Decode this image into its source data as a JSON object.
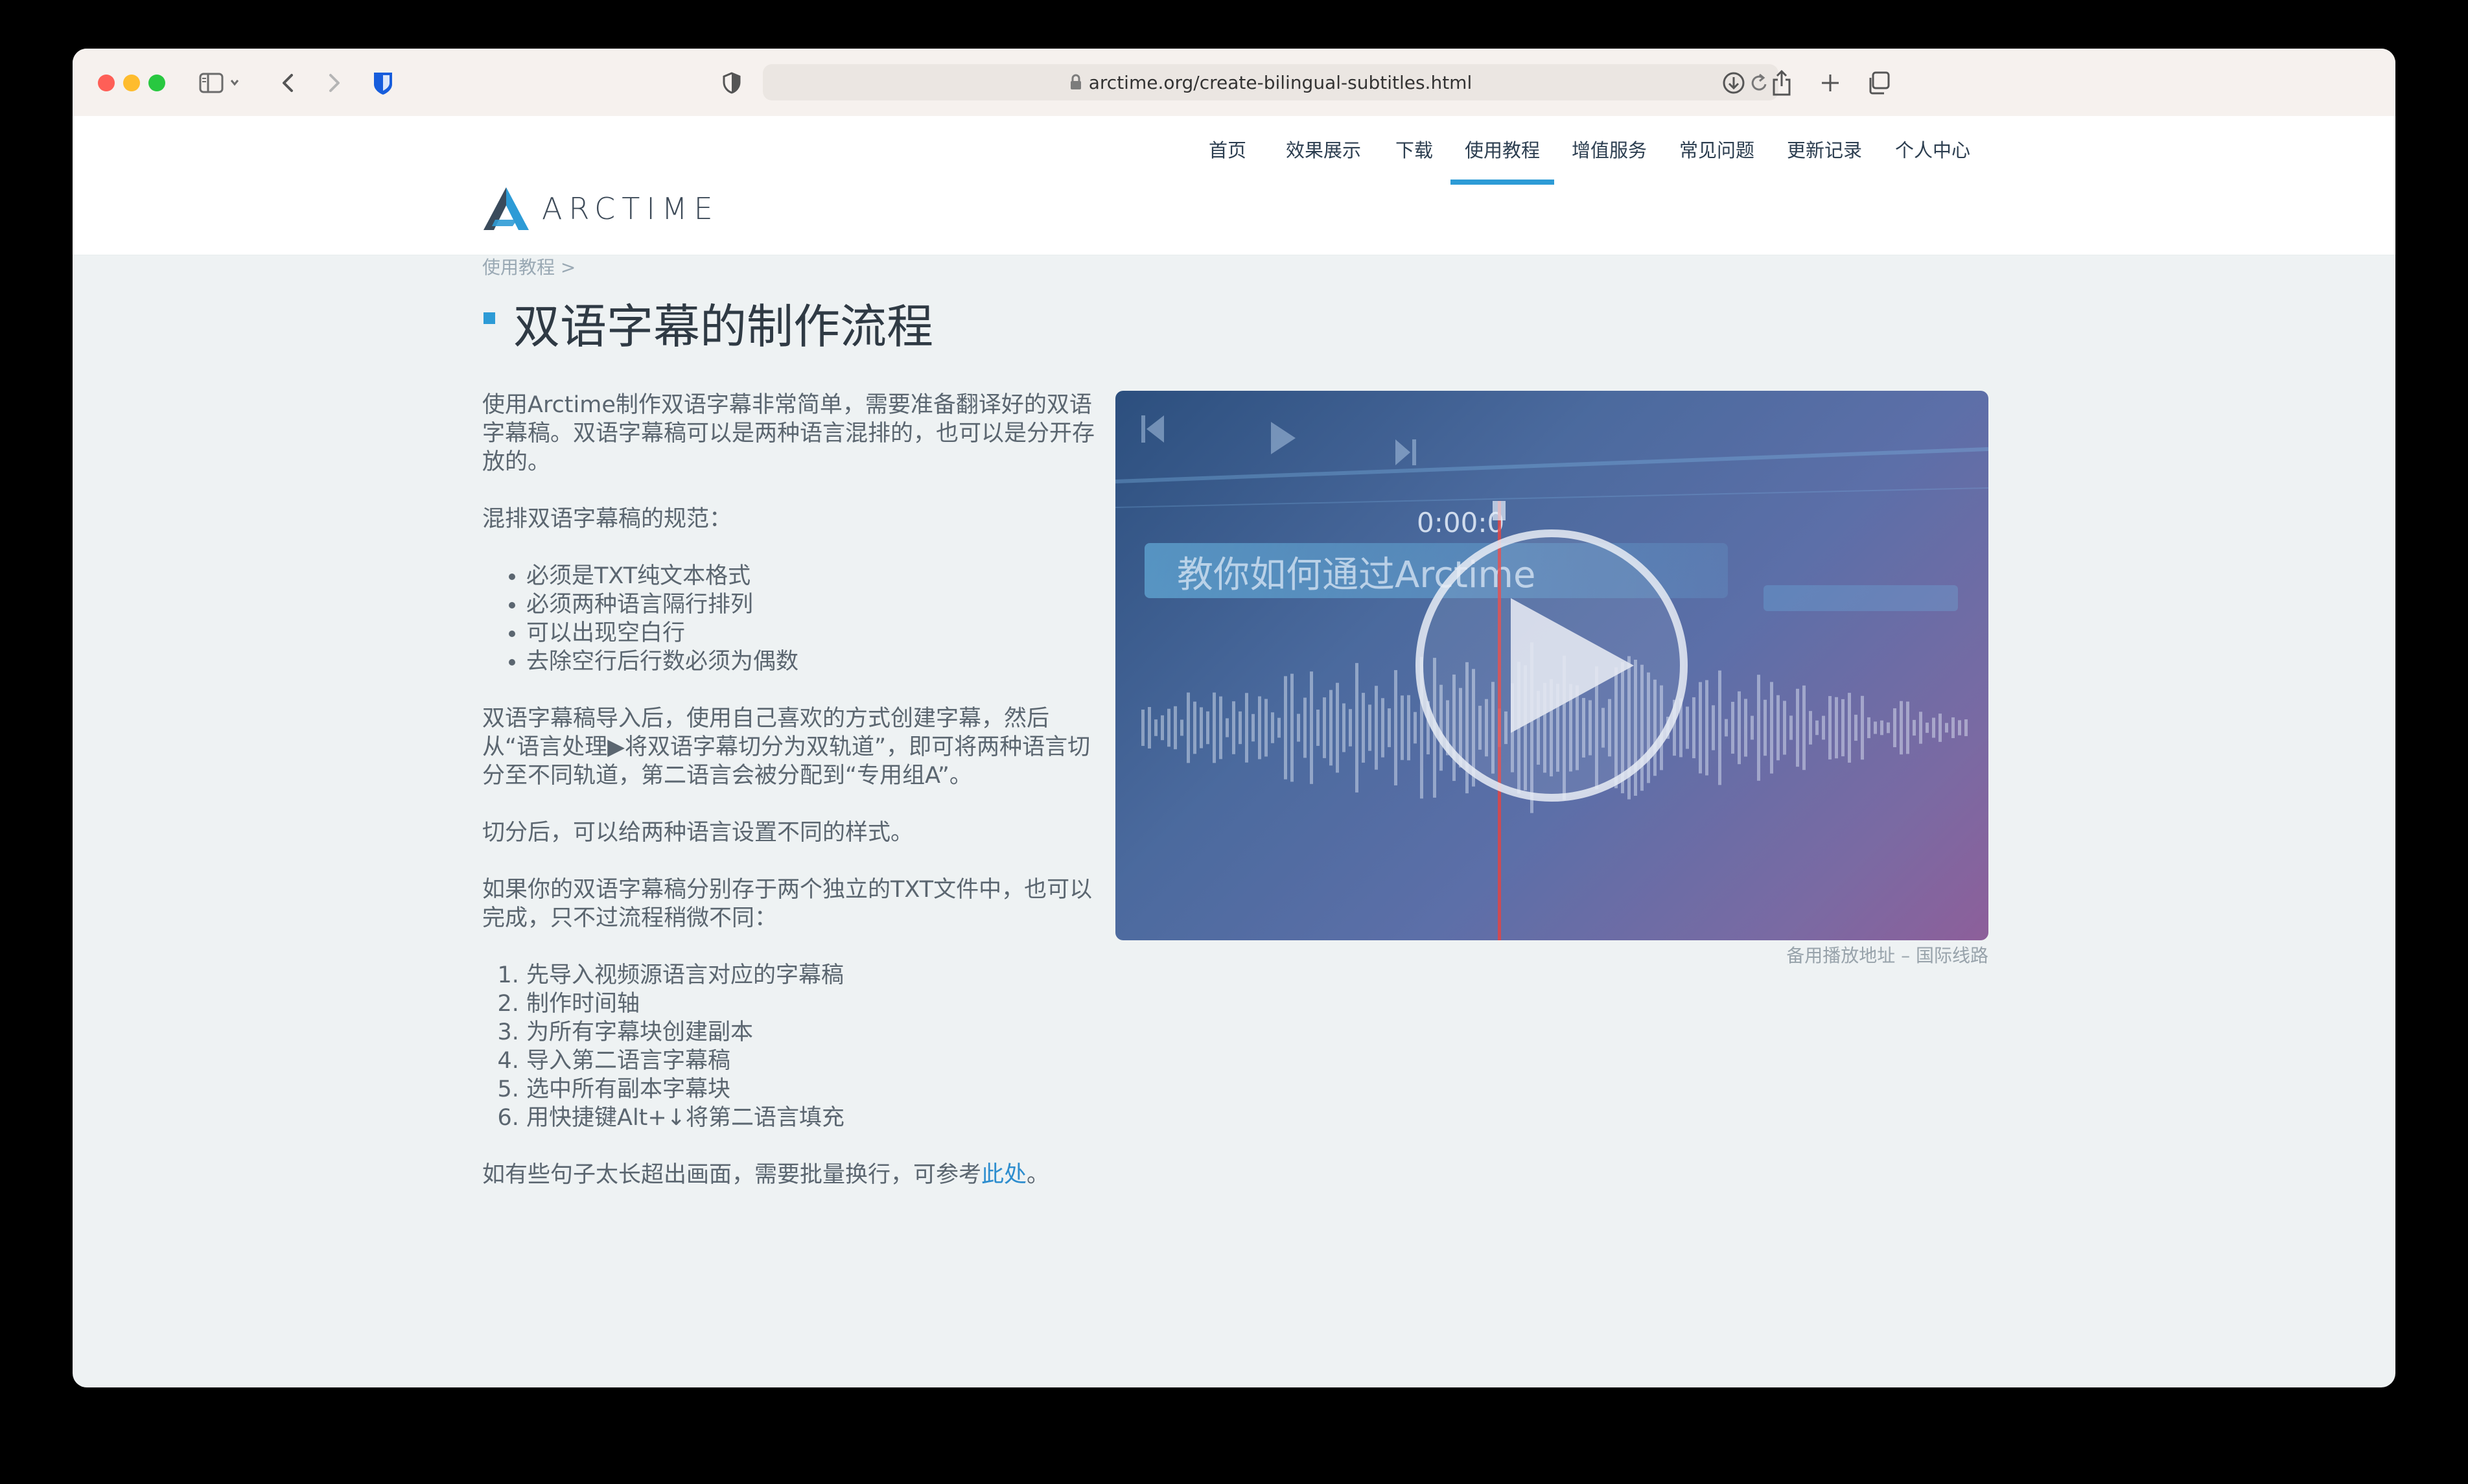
{
  "browser": {
    "url": "arctime.org/create-bilingual-subtitles.html"
  },
  "site": {
    "logo_text": "ARCTIME",
    "nav": [
      {
        "label": "首页",
        "active": false
      },
      {
        "label": "效果展示",
        "active": false
      },
      {
        "label": "下载",
        "active": false
      },
      {
        "label": "使用教程",
        "active": true
      },
      {
        "label": "增值服务",
        "active": false
      },
      {
        "label": "常见问题",
        "active": false
      },
      {
        "label": "更新记录",
        "active": false
      },
      {
        "label": "个人中心",
        "active": false
      }
    ]
  },
  "page": {
    "breadcrumb": "使用教程 >",
    "title": "双语字幕的制作流程",
    "intro": "使用Arctime制作双语字幕非常简单，需要准备翻译好的双语字幕稿。双语字幕稿可以是两种语言混排的，也可以是分开存放的。",
    "mixed_heading": "混排双语字幕稿的规范：",
    "mixed_rules": [
      "必须是TXT纯文本格式",
      "必须两种语言隔行排列",
      "可以出现空白行",
      "去除空行后行数必须为偶数"
    ],
    "import_para": "双语字幕稿导入后，使用自己喜欢的方式创建字幕，然后从“语言处理▶将双语字幕切分为双轨道”，即可将两种语言切分至不同轨道，第二语言会被分配到“专用组A”。",
    "style_para": "切分后，可以给两种语言设置不同的样式。",
    "separate_para": "如果你的双语字幕稿分别存于两个独立的TXT文件中，也可以完成，只不过流程稍微不同：",
    "steps": [
      "先导入视频源语言对应的字幕稿",
      "制作时间轴",
      "为所有字幕块创建副本",
      "导入第二语言字幕稿",
      "选中所有副本字幕块",
      "用快捷键Alt+↓将第二语言填充"
    ],
    "footer_text": "如有些句子太长超出画面，需要批量换行，可参考",
    "footer_link": "此处",
    "footer_end": "。"
  },
  "video": {
    "timecode": "0:00:0",
    "overlay_text": "教你如何通过Arctime",
    "caption": "备用播放地址 – 国际线路"
  },
  "colors": {
    "accent": "#2d9bd6",
    "page_bg": "#eef2f3",
    "playhead": "#e04545"
  }
}
